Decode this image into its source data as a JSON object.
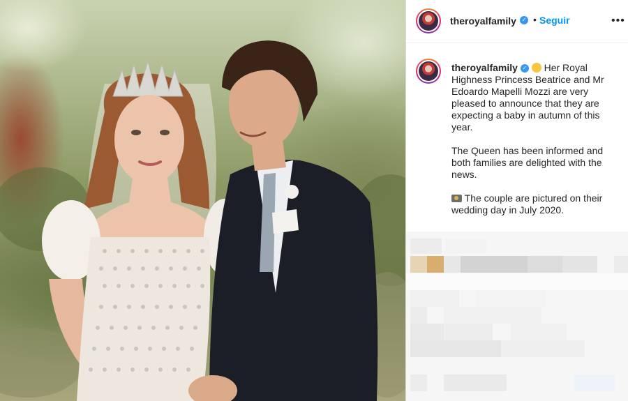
{
  "photo": {
    "alt": "",
    "icon": "wedding-photo"
  },
  "post_header": {
    "username": "theroyalfamily",
    "verified_icon": "verified-badge-icon",
    "separator": "•",
    "follow_label": "Seguir",
    "more_icon": "•••"
  },
  "caption": {
    "username": "theroyalfamily",
    "paragraph1": "Her Royal Highness Princess Beatrice and Mr Edoardo Mapelli Mozzi are very pleased to announce that they are expecting a baby in autumn of this year.",
    "paragraph2": "The Queen has been informed and both families are delighted with the news.",
    "paragraph3": "The couple are pictured on their wedding day in July 2020.",
    "emoji1_icon": "baby-angel-emoji-icon",
    "emoji2_icon": "camera-flash-emoji-icon"
  },
  "colors": {
    "link_blue": "#0095f6",
    "verified_blue": "#3897f0",
    "text": "#262626"
  }
}
